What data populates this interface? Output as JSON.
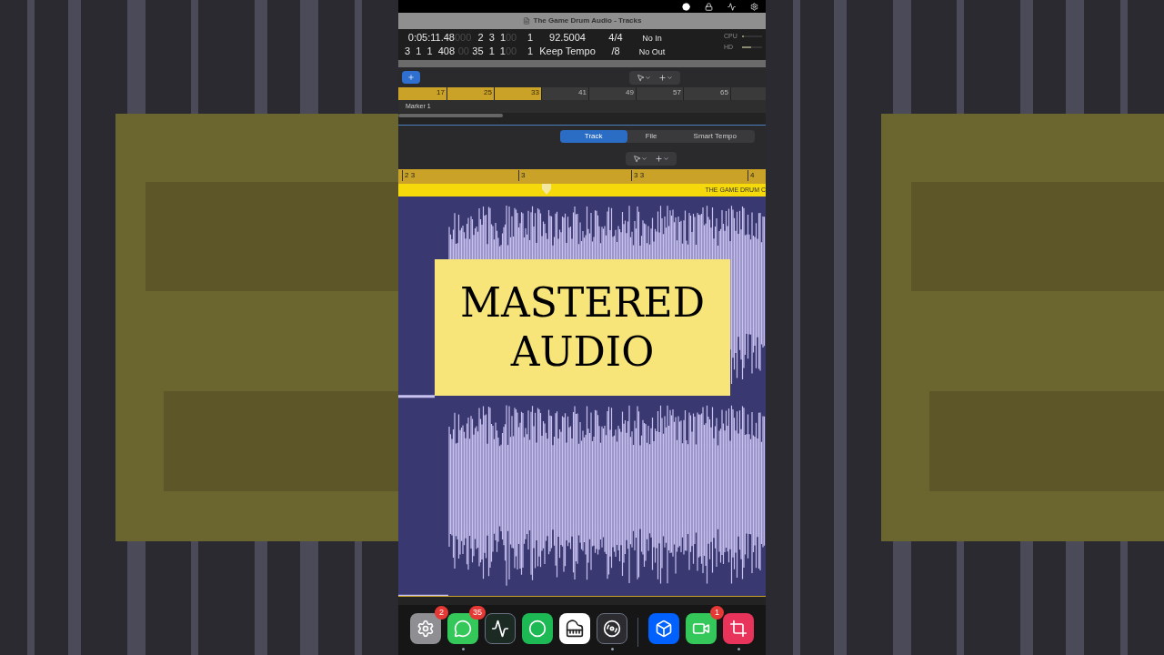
{
  "window": {
    "title": "The Game Drum Audio - Tracks"
  },
  "lcd": {
    "rows": [
      {
        "cells": [
          {
            "text": "0:05:11.48",
            "dim": false
          },
          {
            "text": "000",
            "dim": true
          },
          {
            "text": "2  3  1",
            "dim": false
          },
          {
            "text": "00",
            "dim": true
          },
          {
            "text": "1",
            "dim": false
          },
          {
            "text": "92.5004",
            "dim": false
          },
          {
            "text": "4/4",
            "dim": false
          },
          {
            "text": "No In",
            "dim": false
          }
        ]
      },
      {
        "cells": [
          {
            "text": "3  1  1  408",
            "dim": false
          },
          {
            "text": "00",
            "dim": true
          },
          {
            "text": "35  1  1",
            "dim": false
          },
          {
            "text": "00",
            "dim": true
          },
          {
            "text": "1",
            "dim": false
          },
          {
            "text": "Keep Tempo",
            "dim": false
          },
          {
            "text": "/8",
            "dim": false
          },
          {
            "text": "No Out",
            "dim": false
          }
        ]
      }
    ],
    "meters": [
      {
        "label": "CPU",
        "level": 0.1
      },
      {
        "label": "HD",
        "level": 0.45
      }
    ]
  },
  "bar_ruler": {
    "marks": [
      {
        "label": "17",
        "cycle": true
      },
      {
        "label": "25",
        "cycle": true
      },
      {
        "label": "33",
        "cycle": true
      },
      {
        "label": "41",
        "cycle": false
      },
      {
        "label": "49",
        "cycle": false
      },
      {
        "label": "57",
        "cycle": false
      },
      {
        "label": "65",
        "cycle": false
      }
    ],
    "marker": "Marker 1"
  },
  "tabs": [
    {
      "label": "Track",
      "selected": true
    },
    {
      "label": "File",
      "selected": false
    },
    {
      "label": "Smart Tempo",
      "selected": false
    }
  ],
  "editor_ruler": [
    "2 3",
    "3",
    "3 3",
    "4"
  ],
  "region": {
    "name": "THE GAME DRUM C"
  },
  "caption": [
    "MASTERED",
    "AUDIO"
  ],
  "dock": [
    {
      "kind": "settings",
      "badge": "2",
      "running": false
    },
    {
      "kind": "messages",
      "badge": "35",
      "running": true
    },
    {
      "kind": "activity",
      "running": false
    },
    {
      "kind": "spotify",
      "running": false
    },
    {
      "kind": "piano",
      "running": false
    },
    {
      "kind": "logic",
      "running": true
    },
    {
      "kind": "divider"
    },
    {
      "kind": "dropbox",
      "running": false
    },
    {
      "kind": "facetime",
      "badge": "1",
      "running": false
    },
    {
      "kind": "inshot",
      "running": true
    }
  ]
}
